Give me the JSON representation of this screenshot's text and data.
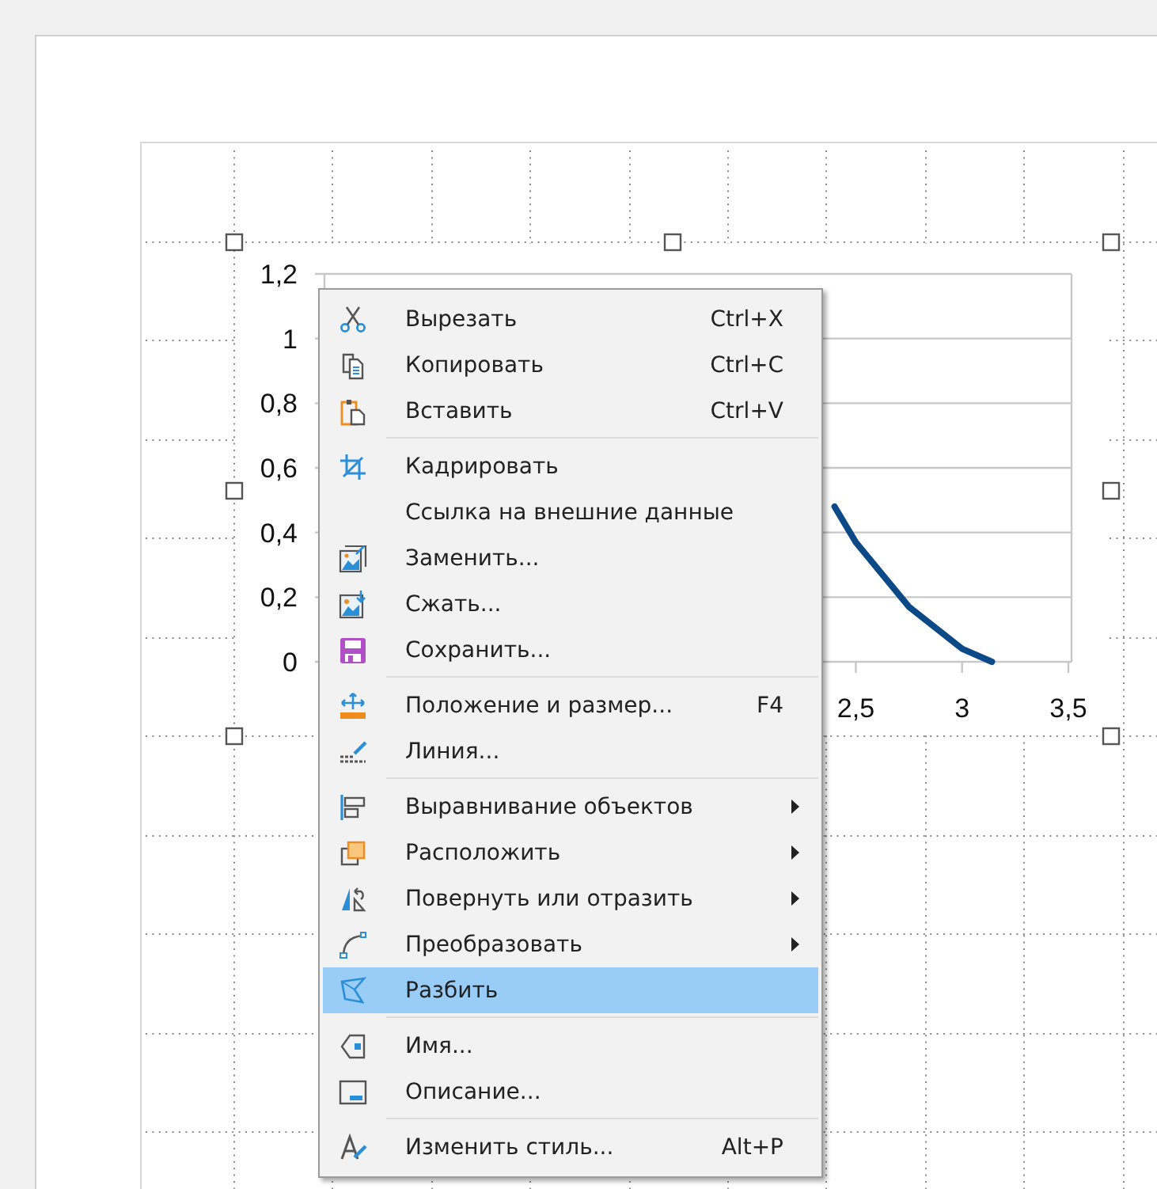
{
  "chart": {
    "chart_data": {
      "type": "line",
      "grid": true,
      "xlim": [
        0,
        3.5
      ],
      "ylim": [
        0,
        1.2
      ],
      "x": [
        2.4,
        2.5,
        2.75,
        3,
        3.14
      ],
      "series": [
        {
          "color": "#0b4a86",
          "values": [
            0.48,
            0.37,
            0.17,
            0.04,
            0.0
          ]
        }
      ],
      "xticks": [
        {
          "value": 2.5,
          "label": "2,5"
        },
        {
          "value": 3,
          "label": "3"
        },
        {
          "value": 3.5,
          "label": "3,5"
        }
      ],
      "yticks": [
        {
          "value": 0,
          "label": "0"
        },
        {
          "value": 0.2,
          "label": "0,2"
        },
        {
          "value": 0.4,
          "label": "0,4"
        },
        {
          "value": 0.6,
          "label": "0,6"
        },
        {
          "value": 0.8,
          "label": "0,8"
        },
        {
          "value": 1,
          "label": "1"
        },
        {
          "value": 1.2,
          "label": "1,2"
        }
      ]
    }
  },
  "context_menu": {
    "groups": [
      [
        {
          "label": "Вырезать",
          "shortcut": "Ctrl+X",
          "submenu": false,
          "selected": false
        },
        {
          "label": "Копировать",
          "shortcut": "Ctrl+C",
          "submenu": false,
          "selected": false
        },
        {
          "label": "Вставить",
          "shortcut": "Ctrl+V",
          "submenu": false,
          "selected": false
        }
      ],
      [
        {
          "label": "Кадрировать",
          "submenu": false,
          "selected": false
        },
        {
          "label": "Ссылка на внешние данные",
          "submenu": false,
          "selected": false
        },
        {
          "label": "Заменить...",
          "submenu": false,
          "selected": false
        },
        {
          "label": "Сжать...",
          "submenu": false,
          "selected": false
        },
        {
          "label": "Сохранить...",
          "submenu": false,
          "selected": false
        }
      ],
      [
        {
          "label": "Положение и размер...",
          "shortcut": "F4",
          "submenu": false,
          "selected": false
        },
        {
          "label": "Линия...",
          "submenu": false,
          "selected": false
        }
      ],
      [
        {
          "label": "Выравнивание объектов",
          "submenu": true,
          "selected": false
        },
        {
          "label": "Расположить",
          "submenu": true,
          "selected": false
        },
        {
          "label": "Повернуть или отразить",
          "submenu": true,
          "selected": false
        },
        {
          "label": "Преобразовать",
          "submenu": true,
          "selected": false
        },
        {
          "label": "Разбить",
          "submenu": false,
          "selected": true
        }
      ],
      [
        {
          "label": "Имя...",
          "submenu": false,
          "selected": false
        },
        {
          "label": "Описание...",
          "submenu": false,
          "selected": false
        }
      ],
      [
        {
          "label": "Изменить стиль...",
          "shortcut": "Alt+P",
          "submenu": false,
          "selected": false
        }
      ]
    ]
  }
}
